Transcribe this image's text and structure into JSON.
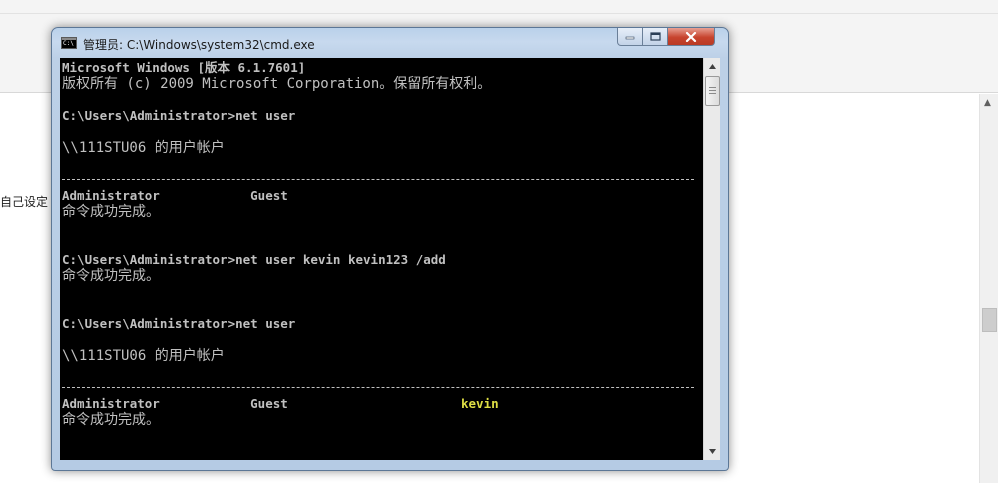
{
  "background": {
    "left_text": "自己设定"
  },
  "window": {
    "title": "管理员: C:\\Windows\\system32\\cmd.exe",
    "icon": "cmd-icon",
    "icon_label": "C:\\",
    "controls": [
      "minimize-icon",
      "maximize-icon",
      "close-icon"
    ]
  },
  "console": {
    "lines": [
      "Microsoft Windows [版本 6.1.7601]",
      "版权所有 (c) 2009 Microsoft Corporation。保留所有权利。",
      "C:\\Users\\Administrator>net user",
      "\\\\111STU06 的用户帐户",
      "Administrator            Guest",
      "命令成功完成。",
      "C:\\Users\\Administrator>net user kevin kevin123 /add",
      "命令成功完成。",
      "C:\\Users\\Administrator>net user",
      "\\\\111STU06 的用户帐户",
      "Administrator            Guest",
      "kevin",
      "命令成功完成。"
    ]
  },
  "colors": {
    "console_bg": "#000000",
    "console_text": "#c0c0c0",
    "highlight_text": "#dede44",
    "titlebar": "#b9d1ea",
    "close_button": "#c7442e"
  }
}
